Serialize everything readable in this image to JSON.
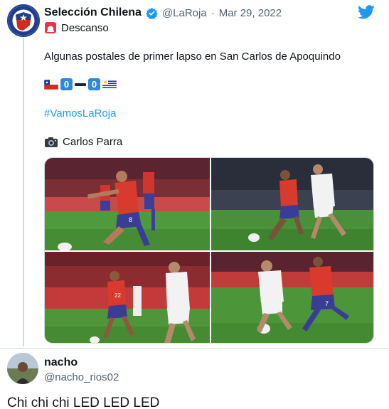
{
  "tweet": {
    "display_name": "Selección Chilena",
    "handle": "@LaRoja",
    "separator": "·",
    "date": "Mar 29, 2022",
    "status_line": "Descanso",
    "body_text": "Algunas postales de primer lapso en San Carlos de Apoquindo",
    "score": {
      "home_flag": "chile-flag",
      "home": "0",
      "away": "0",
      "away_flag": "uruguay-flag"
    },
    "hashtag": "#VamosLaRoja",
    "photo_credit": "Carlos Parra",
    "photos": [
      {
        "name": "photo-1",
        "jersey": "8"
      },
      {
        "name": "photo-2",
        "jersey": ""
      },
      {
        "name": "photo-3",
        "jersey": "22"
      },
      {
        "name": "photo-4",
        "jersey": "7"
      }
    ],
    "icons": [
      "verified-badge-icon",
      "twitter-bird-icon",
      "siren-icon",
      "camera-icon"
    ],
    "colors": {
      "accent": "#1d9bf0",
      "muted": "#536471",
      "score_box": "#2f88d8"
    }
  },
  "reply": {
    "display_name": "nacho",
    "handle": "@nacho_rios02",
    "text": "Chi chi chi LED LED LED"
  }
}
